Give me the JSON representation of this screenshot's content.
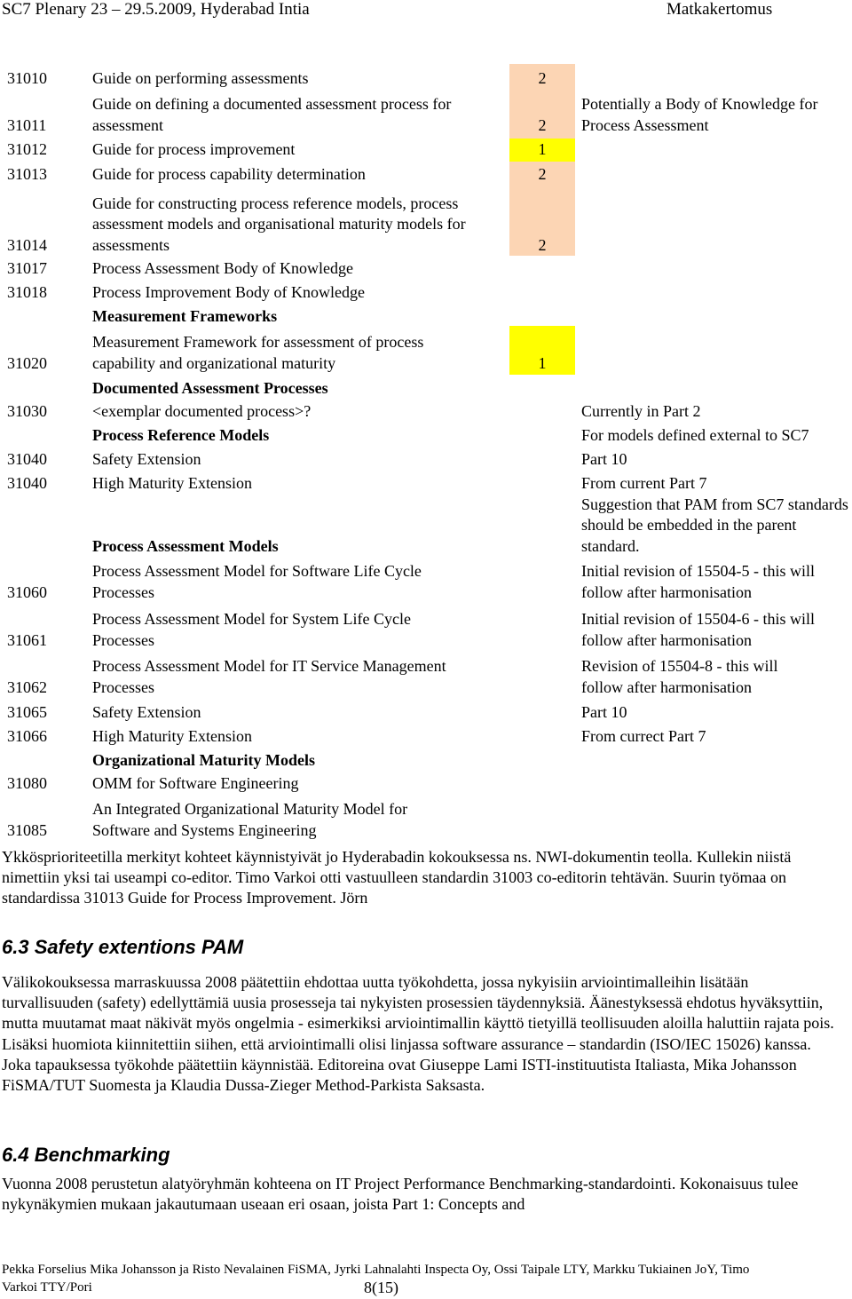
{
  "header": {
    "left": "SC7 Plenary 23 – 29.5.2009, Hyderabad Intia",
    "right": "Matkakertomus"
  },
  "colors": {
    "priority_2": "#FCD5B4",
    "priority_1": "#FFFF00"
  },
  "table": {
    "rows": [
      {
        "id": "31010",
        "title": "Guide on performing assessments",
        "priority": "2",
        "note": ""
      },
      {
        "id": "31011",
        "title": "Guide on defining a documented assessment process for assessment",
        "priority": "2",
        "note": "Potentially a Body of Knowledge for Process Assessment"
      },
      {
        "id": "31012",
        "title": "Guide for process improvement",
        "priority": "1",
        "note": ""
      },
      {
        "id": "31013",
        "title": "Guide for process capability determination",
        "priority": "2",
        "note": ""
      },
      {
        "id": "31014",
        "title": "Guide for constructing process reference models, process assessment models and organisational maturity models for assessments",
        "priority": "2",
        "note": ""
      },
      {
        "id": "31017",
        "title": "Process Assessment Body of Knowledge",
        "priority": "",
        "note": ""
      },
      {
        "id": "31018",
        "title": "Process Improvement Body of Knowledge",
        "priority": "",
        "note": ""
      },
      {
        "id": "",
        "title": "Measurement Frameworks",
        "priority": "",
        "note": "",
        "section": true
      },
      {
        "id": "31020",
        "title": "Measurement Framework for assessment of process capability and organizational maturity",
        "priority": "1",
        "note": ""
      },
      {
        "id": "",
        "title": "Documented Assessment Processes",
        "priority": "",
        "note": "",
        "section": true
      },
      {
        "id": "31030",
        "title": "<exemplar documented process>?",
        "priority": "",
        "note": "Currently in Part 2"
      },
      {
        "id": "",
        "title": "Process Reference Models",
        "priority": "",
        "note": "For models defined external to SC7",
        "section": true
      },
      {
        "id": "31040",
        "title": "Safety Extension",
        "priority": "",
        "note": "Part 10"
      },
      {
        "id": "31040",
        "title": "High Maturity Extension",
        "priority": "",
        "note": "From current Part 7"
      },
      {
        "id": "",
        "title": "Process Assessment Models",
        "priority": "",
        "note": "Suggestion that PAM from SC7 standards should be embedded in the parent standard.",
        "section": true
      },
      {
        "id": "31060",
        "title": "Process Assessment Model for Software Life Cycle Processes",
        "priority": "",
        "note": "Initial revision of 15504-5 - this will follow after harmonisation"
      },
      {
        "id": "31061",
        "title": "Process Assessment Model for System Life Cycle Processes",
        "priority": "",
        "note": "Initial revision of 15504-6 - this will follow after harmonisation"
      },
      {
        "id": "31062",
        "title": "Process Assessment Model for IT Service Management Processes",
        "priority": "",
        "note": "Revision of 15504-8 - this will follow after harmonisation"
      },
      {
        "id": "31065",
        "title": "Safety Extension",
        "priority": "",
        "note": "Part 10"
      },
      {
        "id": "31066",
        "title": "High Maturity Extension",
        "priority": "",
        "note": "From currect Part 7"
      },
      {
        "id": "",
        "title": "Organizational Maturity Models",
        "priority": "",
        "note": "",
        "section": true
      },
      {
        "id": "31080",
        "title": "OMM for Software Engineering",
        "priority": "",
        "note": ""
      },
      {
        "id": "31085",
        "title": "An Integrated Organizational Maturity Model for Software and Systems Engineering",
        "priority": "",
        "note": ""
      }
    ]
  },
  "para1": "Ykkösprioriteetilla merkityt kohteet käynnistyivät jo Hyderabadin kokouksessa ns. NWI-dokumentin teolla. Kullekin niistä nimettiin yksi tai useampi co-editor. Timo Varkoi otti vastuulleen standardin 31003 co-editorin tehtävän. Suurin työmaa on standardissa 31013 Guide for Process Improvement. Jörn",
  "section63": {
    "heading": "6.3 Safety extentions PAM",
    "body": "Välikokouksessa marraskuussa 2008 päätettiin ehdottaa uutta työkohdetta, jossa nykyisiin arviointimalleihin lisätään turvallisuuden (safety) edellyttämiä uusia prosesseja tai nykyisten prosessien täydennyksiä. Äänestyksessä ehdotus hyväksyttiin, mutta muutamat maat näkivät myös ongelmia - esimerkiksi arviointimallin käyttö tietyillä teollisuuden aloilla haluttiin rajata pois. Lisäksi huomiota kiinnitettiin siihen, että arviointimalli olisi linjassa software assurance – standardin (ISO/IEC 15026) kanssa. Joka tapauksessa työkohde päätettiin käynnistää. Editoreina ovat Giuseppe Lami ISTI-instituutista Italiasta, Mika Johansson FiSMA/TUT Suomesta ja Klaudia Dussa-Zieger Method-Parkista Saksasta."
  },
  "section64": {
    "heading": "6.4 Benchmarking",
    "body": "Vuonna 2008 perustetun alatyöryhmän kohteena on IT Project Performance Benchmarking-standardointi. Kokonaisuus tulee nykynäkymien mukaan jakautumaan useaan eri osaan, joista Part 1: Concepts and"
  },
  "footer": {
    "authors": "Pekka Forselius Mika Johansson ja Risto Nevalainen FiSMA, Jyrki Lahnalahti Inspecta Oy, Ossi Taipale LTY, Markku Tukiainen JoY, Timo Varkoi TTY/Pori",
    "page": "8(15)"
  }
}
